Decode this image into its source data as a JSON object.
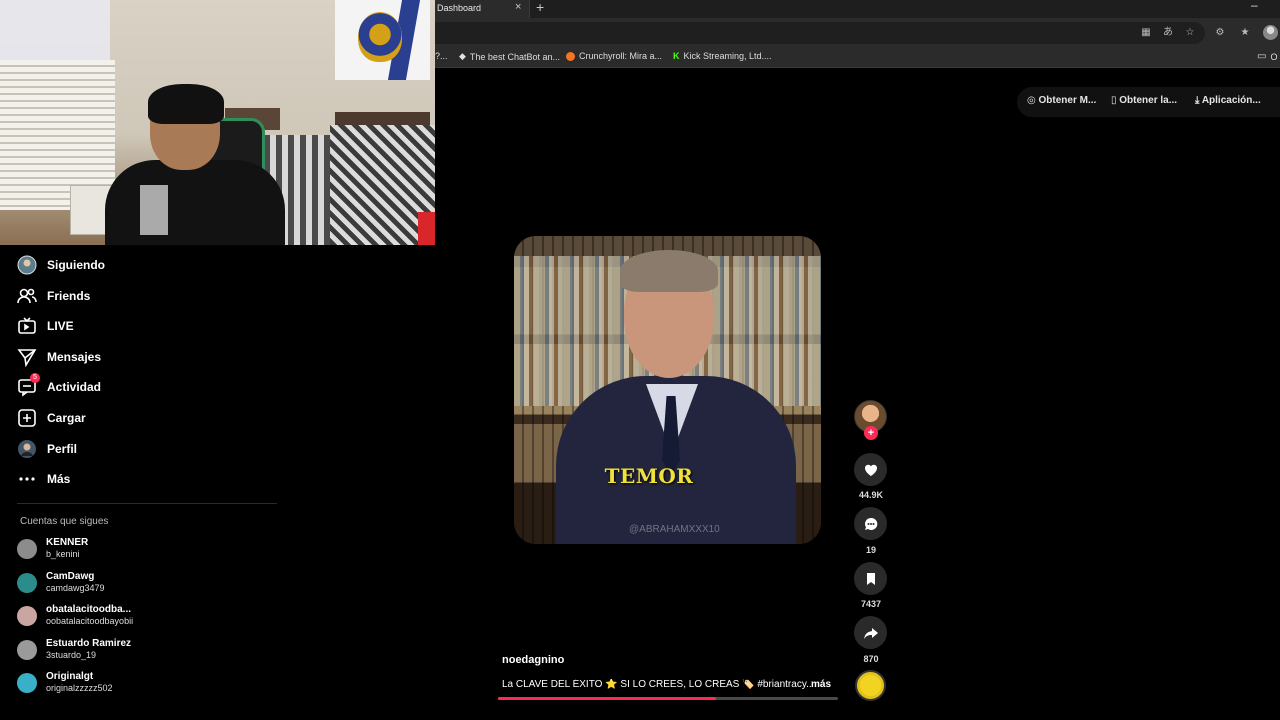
{
  "browser": {
    "tab_title": "Dashboard",
    "tab_close": "×",
    "new_tab": "+",
    "minimize": "–",
    "bookmarks": [
      {
        "label": "?...",
        "icon": "truncated"
      },
      {
        "label": "The best ChatBot an...",
        "icon": "chatbot-icon",
        "color": "#e0e0e0"
      },
      {
        "label": "Crunchyroll: Mira a...",
        "icon": "crunchyroll-icon",
        "color": "#f47521"
      },
      {
        "label": "Kick Streaming, Ltd....",
        "icon": "kick-icon",
        "color": "#53fc18"
      }
    ]
  },
  "top_buttons": {
    "get_m": "Obtener M...",
    "get_la": "Obtener la...",
    "app": "Aplicación..."
  },
  "sidebar": {
    "items": [
      {
        "label": "Siguiendo",
        "icon": "avatar-icon"
      },
      {
        "label": "Friends",
        "icon": "friends-icon"
      },
      {
        "label": "LIVE",
        "icon": "live-icon"
      },
      {
        "label": "Mensajes",
        "icon": "messages-icon"
      },
      {
        "label": "Actividad",
        "icon": "activity-icon",
        "badge": "5"
      },
      {
        "label": "Cargar",
        "icon": "upload-icon"
      },
      {
        "label": "Perfil",
        "icon": "profile-icon"
      },
      {
        "label": "Más",
        "icon": "more-icon"
      }
    ],
    "following_title": "Cuentas que sigues",
    "accounts": [
      {
        "name": "KENNER",
        "handle": "b_kenini",
        "color": "#8c8c8c"
      },
      {
        "name": "CamDawg",
        "handle": "camdawg3479",
        "color": "#2b8c8c"
      },
      {
        "name": "obatalacitoodba...",
        "handle": "oobatalacitoodbayobii",
        "color": "#c9a6a0"
      },
      {
        "name": "Estuardo Ramirez",
        "handle": "3stuardo_19",
        "color": "#9a9a9a"
      },
      {
        "name": "Originalgt",
        "handle": "originalzzzzz502",
        "color": "#3ab0c8"
      }
    ]
  },
  "video": {
    "caption": "TEMOR",
    "watermark": "@ABRAHAMXXX10",
    "author": "noedagnino",
    "description": "La CLAVE DEL ÉXITO ⭐ SI LO CREES, LO CREAS 🏷️ #briantracy...",
    "more": "más",
    "progress": 0.64
  },
  "actions": {
    "likes": "44.9K",
    "comments": "19",
    "saves": "7437",
    "shares": "870",
    "follow_plus": "+"
  },
  "colors": {
    "accent": "#fe2c55",
    "caption": "#f1e23a"
  }
}
